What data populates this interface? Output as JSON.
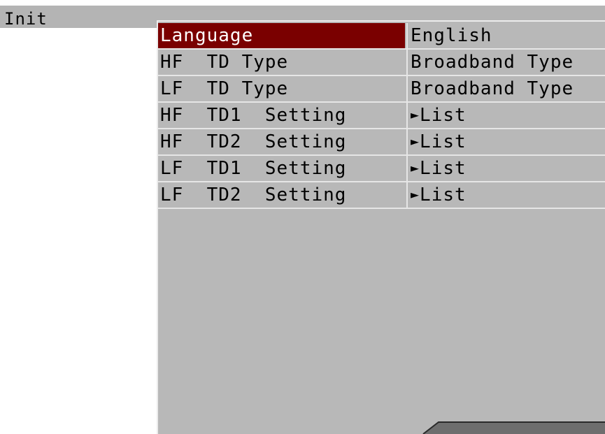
{
  "window": {
    "title": "Init"
  },
  "menu": {
    "rows": [
      {
        "label": "Language",
        "value": "English",
        "arrow": ""
      },
      {
        "label": "HF  TD Type",
        "value": "Broadband Type",
        "arrow": ""
      },
      {
        "label": "LF  TD Type",
        "value": "Broadband Type",
        "arrow": ""
      },
      {
        "label": "HF  TD1  Setting",
        "value": "List",
        "arrow": "►"
      },
      {
        "label": "HF  TD2  Setting",
        "value": "List",
        "arrow": "►"
      },
      {
        "label": "LF  TD1  Setting",
        "value": "List",
        "arrow": "►"
      },
      {
        "label": "LF  TD2  Setting",
        "value": "List",
        "arrow": "►"
      }
    ],
    "selected_index": 0
  },
  "colors": {
    "panel_bg": "#b8b8b8",
    "title_bar_bg": "#b4b4b4",
    "selected_bg": "#7a0000",
    "selected_text": "#ffffff"
  }
}
